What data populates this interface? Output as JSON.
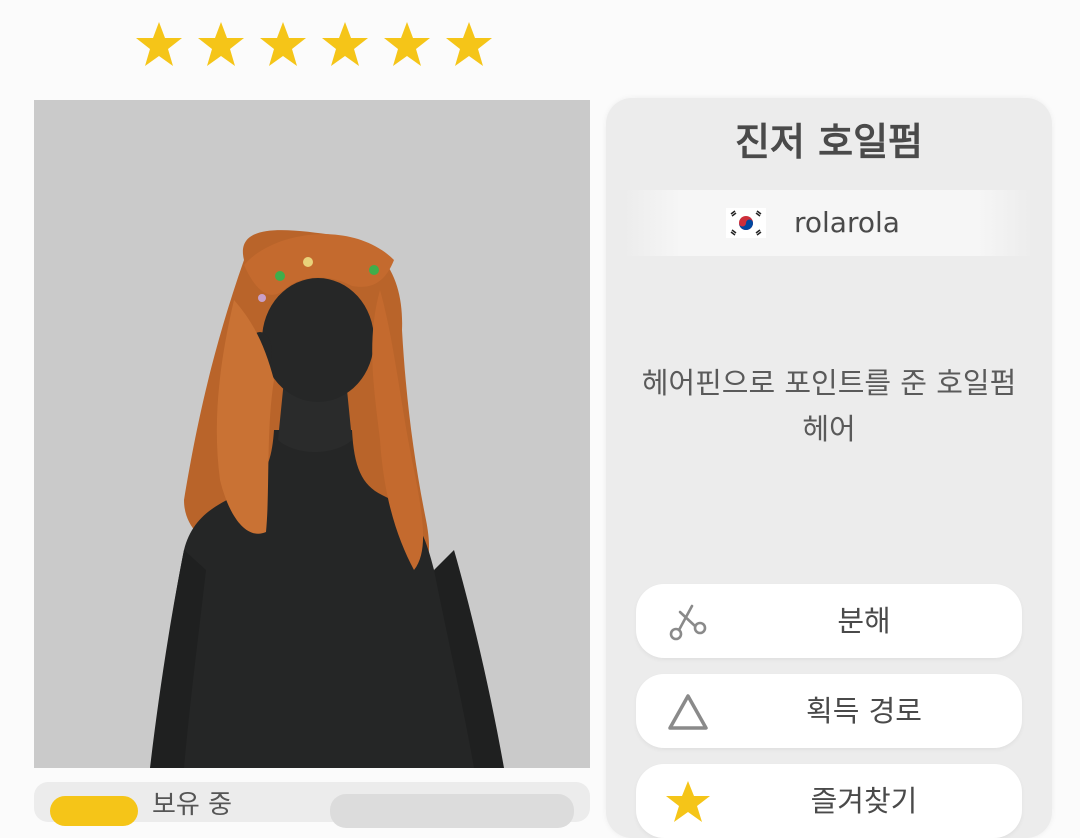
{
  "rating": {
    "stars": 6,
    "star_color": "#f5c518",
    "icon": "star-icon"
  },
  "item": {
    "title": "진저 호일펌",
    "creator_flag": "south-korea-flag-icon",
    "creator_name": "rolarola",
    "description_line1": "헤어핀으로 포인트를 준 호일펌",
    "description_line2": "헤어"
  },
  "inventory": {
    "owned_label": "보유 중"
  },
  "actions": [
    {
      "label": "분해",
      "icon": "scissors-icon"
    },
    {
      "label": "획득 경로",
      "icon": "triangle-icon"
    },
    {
      "label": "즐겨찾기",
      "icon": "star-icon"
    }
  ],
  "colors": {
    "accent": "#f5c518",
    "panel_bg": "#ececec",
    "preview_bg": "#cacaca",
    "hair": "#c46a2e"
  }
}
